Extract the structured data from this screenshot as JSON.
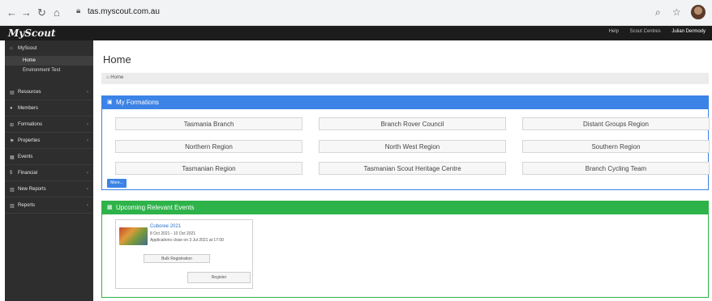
{
  "browser": {
    "url": "tas.myscout.com.au",
    "icons": {
      "back": "back-arrow-icon",
      "forward": "forward-arrow-icon",
      "reload": "reload-icon",
      "home": "home-icon",
      "lock": "lock-icon",
      "zoom": "zoom-icon",
      "star": "star-icon",
      "profile": "profile-avatar"
    }
  },
  "topbar": {
    "logo": "MyScout",
    "links": [
      "Help",
      "Scout Centres"
    ],
    "user": "Julian Dermody"
  },
  "sidebar": {
    "items": [
      {
        "label": "MyScout",
        "icon": "home-icon",
        "has_arrow": false
      },
      {
        "label": "Resources",
        "icon": "book-icon",
        "has_arrow": true
      },
      {
        "label": "Members",
        "icon": "user-icon",
        "has_arrow": false
      },
      {
        "label": "Formations",
        "icon": "sitemap-icon",
        "has_arrow": true
      },
      {
        "label": "Properties",
        "icon": "flag-icon",
        "has_arrow": true
      },
      {
        "label": "Events",
        "icon": "calendar-icon",
        "has_arrow": false
      },
      {
        "label": "Financial",
        "icon": "dollar-icon",
        "has_arrow": true
      },
      {
        "label": "New Reports",
        "icon": "chart-icon",
        "has_arrow": true
      },
      {
        "label": "Reports",
        "icon": "chart-icon",
        "has_arrow": true
      }
    ],
    "subitems": [
      {
        "label": "Home",
        "active": true
      },
      {
        "label": "Environment Test",
        "active": false
      }
    ]
  },
  "main": {
    "title": "Home",
    "breadcrumb": "Home",
    "formations": {
      "title": "My Formations",
      "items": [
        "Tasmania Branch",
        "Branch Rover Council",
        "Distant Groups Region",
        "Northern Region",
        "North West Region",
        "Southern Region",
        "Tasmanian Region",
        "Tasmanian Scout Heritage Centre",
        "Branch Cycling Team"
      ],
      "more_label": "More..."
    },
    "events": {
      "title": "Upcoming Relevant Events",
      "event": {
        "name": "Cuboree 2021",
        "dates": "8 Oct 2021 - 10 Oct 2021",
        "applications": "Applications close on 3 Jul 2021 at 17:00",
        "bulk_label": "Bulk Registration",
        "register_label": "Register"
      }
    }
  }
}
